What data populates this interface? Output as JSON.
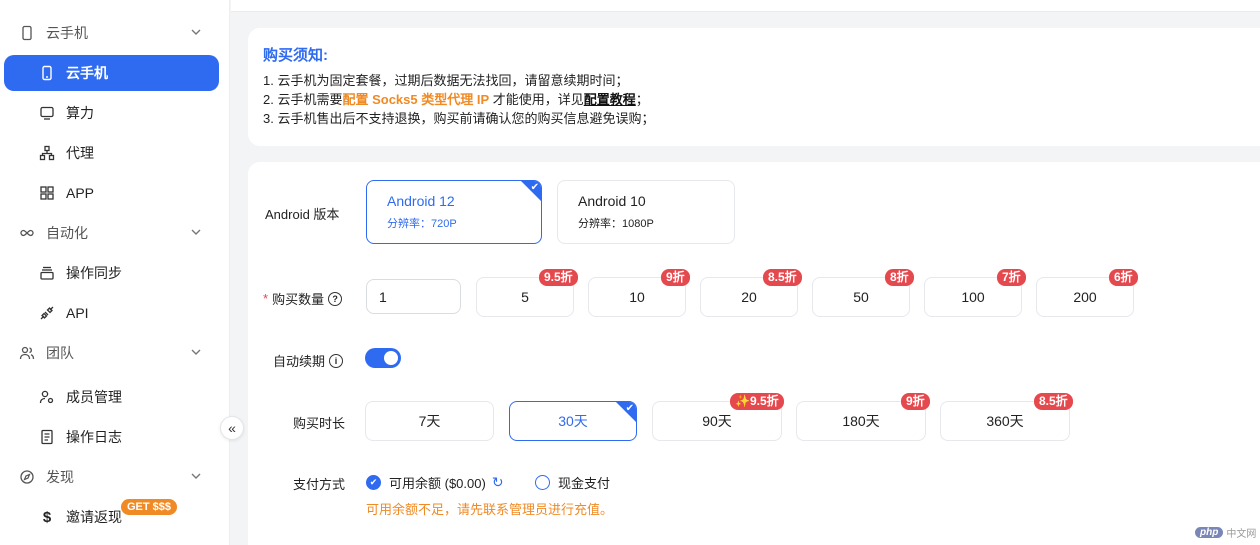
{
  "sidebar": {
    "groups": [
      {
        "label": "云手机"
      },
      {
        "label": "自动化"
      },
      {
        "label": "团队"
      },
      {
        "label": "发现"
      }
    ],
    "items": [
      {
        "label": "云手机"
      },
      {
        "label": "算力"
      },
      {
        "label": "代理"
      },
      {
        "label": "APP"
      },
      {
        "label": "操作同步"
      },
      {
        "label": "API"
      },
      {
        "label": "成员管理"
      },
      {
        "label": "操作日志"
      },
      {
        "label": "邀请返现"
      }
    ],
    "get_badge": "GET $$$",
    "collapse_glyph": "«"
  },
  "notice": {
    "title": "购买须知:",
    "line1": "1. 云手机为固定套餐，过期后数据无法找回，请留意续期时间；",
    "line2_a": "2. 云手机需要",
    "line2_highlight": "配置 Socks5 类型代理 IP",
    "line2_b": " 才能使用，详见",
    "line2_link": "配置教程",
    "line2_c": "；",
    "line3": "3. 云手机售出后不支持退换，购买前请确认您的购买信息避免误购；"
  },
  "form": {
    "android_label": "Android 版本",
    "versions": [
      {
        "name": "Android 12",
        "res": "分辨率：720P",
        "selected": true
      },
      {
        "name": "Android 10",
        "res": "分辨率：1080P",
        "selected": false
      }
    ],
    "qty_label": "购买数量",
    "qty_required": "*",
    "qty_value": "1",
    "qty_options": [
      {
        "label": "5",
        "discount": "9.5折"
      },
      {
        "label": "10",
        "discount": "9折"
      },
      {
        "label": "20",
        "discount": "8.5折"
      },
      {
        "label": "50",
        "discount": "8折"
      },
      {
        "label": "100",
        "discount": "7折"
      },
      {
        "label": "200",
        "discount": "6折"
      }
    ],
    "auto_renew_label": "自动续期",
    "auto_renew_on": true,
    "duration_label": "购买时长",
    "durations": [
      {
        "label": "7天",
        "discount": "",
        "selected": false
      },
      {
        "label": "30天",
        "discount": "",
        "selected": true
      },
      {
        "label": "90天",
        "discount": "✨9.5折",
        "selected": false
      },
      {
        "label": "180天",
        "discount": "9折",
        "selected": false
      },
      {
        "label": "360天",
        "discount": "8.5折",
        "selected": false
      }
    ],
    "payment_label": "支付方式",
    "pay_balance": "可用余额 ($0.00)",
    "pay_cash": "现金支付",
    "warning": "可用余额不足，请先联系管理员进行充值。"
  },
  "watermark": {
    "badge": "php",
    "text": "中文网"
  },
  "colors": {
    "accent": "#2f6bf0",
    "discount": "#e5484d",
    "orange": "#f08a24"
  }
}
